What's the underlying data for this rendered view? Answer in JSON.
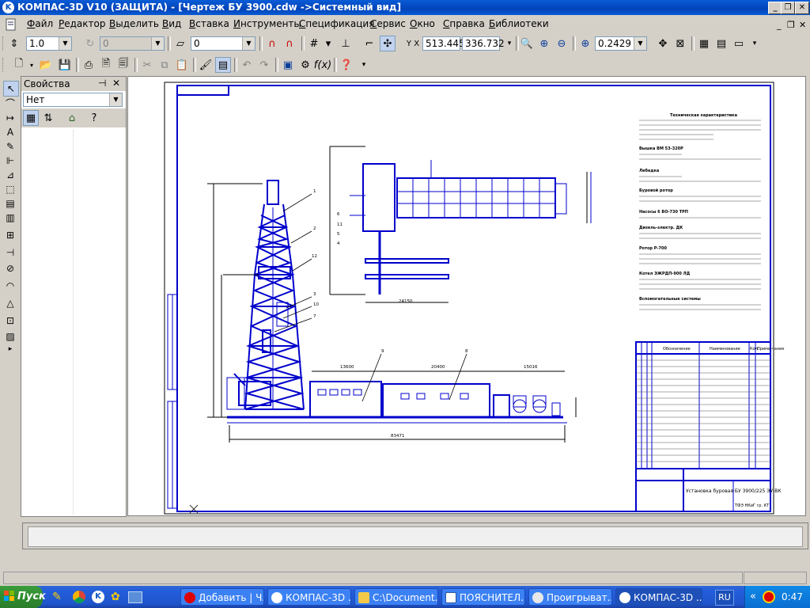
{
  "window": {
    "title": "КОМПАС-3D V10 (ЗАЩИТА) - [Чертеж БУ 3900.cdw ->Системный вид]",
    "app_icon": "kompas-logo-icon"
  },
  "menu": [
    "Файл",
    "Редактор",
    "Выделить",
    "Вид",
    "Вставка",
    "Инструменты",
    "Спецификация",
    "Сервис",
    "Окно",
    "Справка",
    "Библиотеки"
  ],
  "toolbar_current": {
    "step_value": "1.0",
    "angle_value": "0",
    "layer_value": "0",
    "coord_x": "513.445",
    "coord_y": "336.732",
    "zoom_value": "0.2429"
  },
  "properties_panel": {
    "title": "Свойства",
    "selection_value": "Нет"
  },
  "drawing": {
    "tech_title": "Техническая характеристика",
    "sections": [
      "Вышка ВМ 53-320Р",
      "Лебедка",
      "Буровой ротор",
      "Насосы 6 ВО-730 ТРП",
      "Дизель-электр. ДК",
      "Ротор Р-700",
      "Котел ЭЖРДП-900 ЛД",
      "Вспомогательные системы"
    ],
    "dimensions": [
      "13600",
      "20400",
      "15016",
      "83471",
      "24150"
    ],
    "callouts": [
      "1",
      "2",
      "3",
      "7",
      "9",
      "10",
      "12",
      "4",
      "5",
      "6",
      "8",
      "11"
    ],
    "stamp_title": "Установка буровая БУ 3900/225 ЭУ-ВК",
    "stamp_org": "ТФЭ НКиГ гр. КТ",
    "spec_header": [
      "Обозначение",
      "Наименование",
      "Кол.",
      "Приме-чание"
    ]
  },
  "taskbar": {
    "start_label": "Пуск",
    "tasks": [
      {
        "label": "Добавить | Ч...",
        "icon": "opera-icon"
      },
      {
        "label": "КОМПАС-3D ...",
        "icon": "kompas-icon"
      },
      {
        "label": "C:\\Document...",
        "icon": "folder-icon"
      },
      {
        "label": "ПОЯСНИТЕЛ...",
        "icon": "word-icon"
      },
      {
        "label": "Проигрыват...",
        "icon": "media-player-icon"
      },
      {
        "label": "КОМПАС-3D ...",
        "icon": "kompas-icon"
      }
    ],
    "language": "RU",
    "clock": "0:47"
  }
}
